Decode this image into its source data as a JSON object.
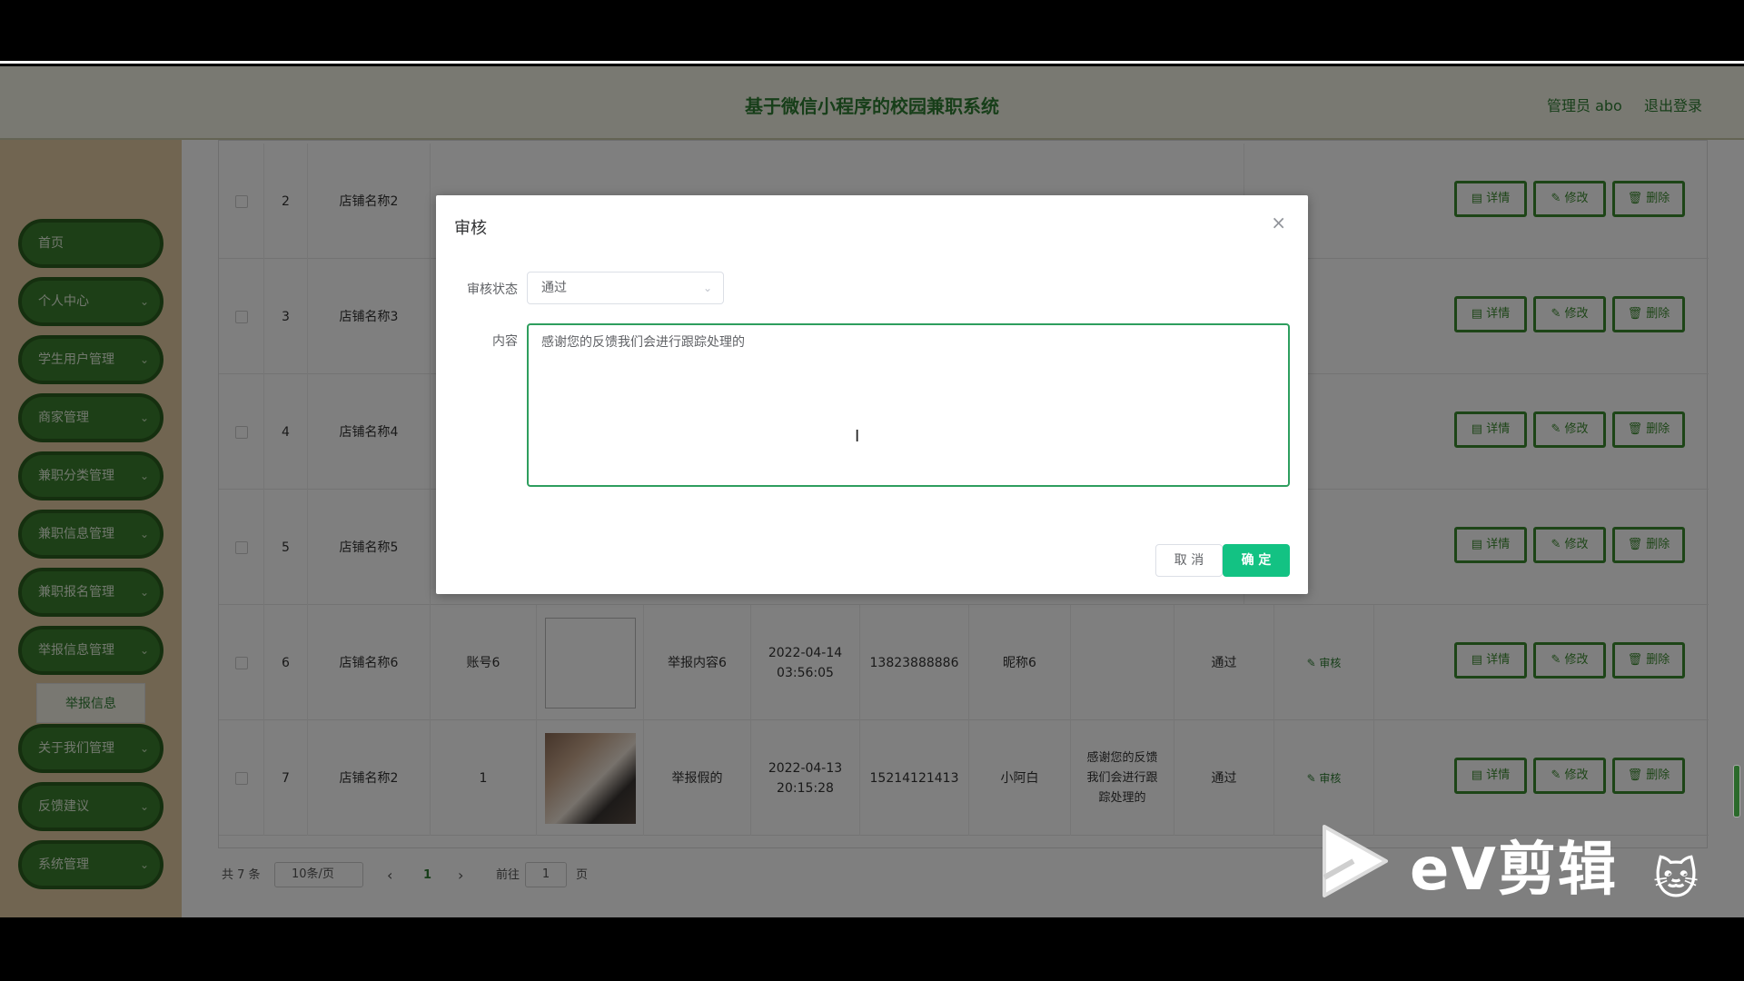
{
  "header": {
    "title": "基于微信小程序的校园兼职系统",
    "admin": "管理员 abo",
    "logout": "退出登录"
  },
  "sidebar": {
    "items": [
      {
        "label": "首页"
      },
      {
        "label": "个人中心"
      },
      {
        "label": "学生用户管理"
      },
      {
        "label": "商家管理"
      },
      {
        "label": "兼职分类管理"
      },
      {
        "label": "兼职信息管理"
      },
      {
        "label": "兼职报名管理"
      },
      {
        "label": "举报信息管理"
      },
      {
        "label": "关于我们管理"
      },
      {
        "label": "反馈建议"
      },
      {
        "label": "系统管理"
      }
    ],
    "sub_item": "举报信息"
  },
  "table": {
    "rows": [
      {
        "no": "2",
        "shop": "店铺名称2",
        "account": "",
        "content": "",
        "time": "",
        "phone": "",
        "nick": "",
        "reply": "",
        "status": ""
      },
      {
        "no": "3",
        "shop": "店铺名称3",
        "account": "",
        "content": "",
        "time": "",
        "phone": "",
        "nick": "",
        "reply": "",
        "status": ""
      },
      {
        "no": "4",
        "shop": "店铺名称4",
        "account": "",
        "content": "",
        "time": "",
        "phone": "",
        "nick": "",
        "reply": "",
        "status": ""
      },
      {
        "no": "5",
        "shop": "店铺名称5",
        "account": "",
        "content": "",
        "time": "",
        "phone": "",
        "nick": "",
        "reply": "",
        "status": ""
      },
      {
        "no": "6",
        "shop": "店铺名称6",
        "account": "账号6",
        "content": "举报内容6",
        "time": "2022-04-14 03:56:05",
        "phone": "13823888886",
        "nick": "昵称6",
        "reply": "",
        "status": "通过"
      },
      {
        "no": "7",
        "shop": "店铺名称2",
        "account": "1",
        "content": "举报假的",
        "time": "2022-04-13 20:15:28",
        "phone": "15214121413",
        "nick": "小阿白",
        "reply": "感谢您的反馈我们会进行跟踪处理的",
        "status": "通过"
      }
    ],
    "audit_label": "✎ 审核",
    "detail_label": "▤ 详情",
    "edit_label": "✎ 修改",
    "delete_label": "🗑 删除"
  },
  "pager": {
    "total": "共 7 条",
    "size": "10条/页",
    "prev": "‹",
    "page": "1",
    "next": "›",
    "goto": "前往",
    "goto_value": "1",
    "unit": "页"
  },
  "dialog": {
    "title": "审核",
    "close": "×",
    "status_label": "审核状态",
    "status_value": "通过",
    "content_label": "内容",
    "content_value": "感谢您的反馈我们会进行跟踪处理的",
    "cancel": "取 消",
    "confirm": "确 定"
  },
  "watermark": {
    "text": "eV剪辑"
  }
}
